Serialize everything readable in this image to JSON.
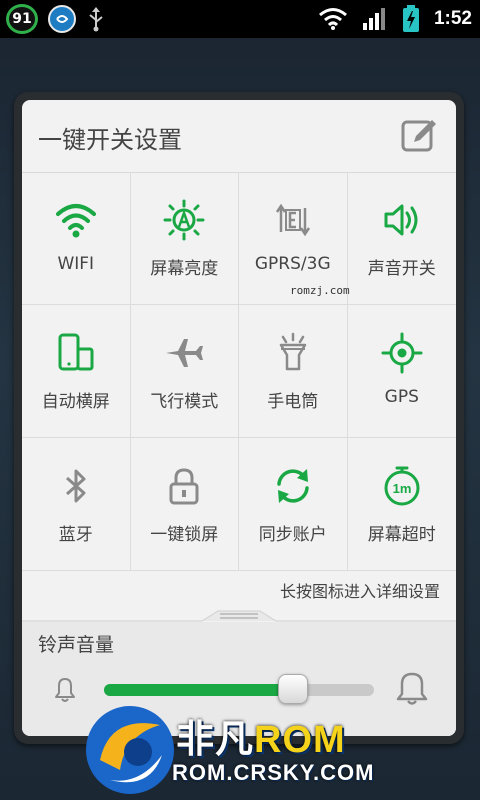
{
  "status_bar": {
    "badge": "91",
    "time": "1:52",
    "icons": [
      "91-badge-icon",
      "swirl-app-icon",
      "usb-icon",
      "wifi-icon",
      "signal-icon",
      "battery-charging-icon"
    ]
  },
  "panel": {
    "title": "一键开关设置",
    "edit_icon": "edit-icon",
    "toggles": [
      {
        "label": "WIFI",
        "icon": "wifi-icon",
        "active": true
      },
      {
        "label": "屏幕亮度",
        "icon": "brightness-auto-icon",
        "active": true
      },
      {
        "label": "GPRS/3G",
        "icon": "data-transfer-icon",
        "active": false
      },
      {
        "label": "声音开关",
        "icon": "speaker-icon",
        "active": true
      },
      {
        "label": "自动横屏",
        "icon": "auto-rotate-icon",
        "active": true
      },
      {
        "label": "飞行模式",
        "icon": "airplane-icon",
        "active": false
      },
      {
        "label": "手电筒",
        "icon": "flashlight-icon",
        "active": false
      },
      {
        "label": "GPS",
        "icon": "gps-icon",
        "active": true
      },
      {
        "label": "蓝牙",
        "icon": "bluetooth-icon",
        "active": false
      },
      {
        "label": "一键锁屏",
        "icon": "lock-icon",
        "active": false
      },
      {
        "label": "同步账户",
        "icon": "sync-icon",
        "active": true
      },
      {
        "label": "屏幕超时",
        "icon": "screen-timeout-icon",
        "active": true
      }
    ],
    "timeout_value": "1m",
    "hint": "长按图标进入详细设置",
    "watermark": "romzj.com"
  },
  "volume": {
    "title": "铃声音量",
    "level": 0.7
  },
  "logo": {
    "brand": "非凡",
    "brand_rom": "ROM",
    "url": "ROM.CRSKY.COM"
  },
  "colors": {
    "active": "#19a844",
    "inactive": "#8a8a8a",
    "text": "#444444"
  }
}
